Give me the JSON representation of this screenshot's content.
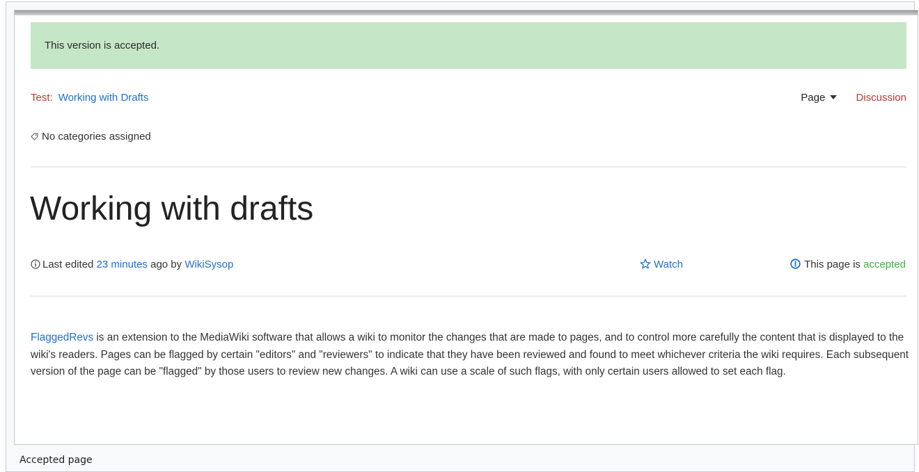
{
  "banner": {
    "text": "This version is accepted."
  },
  "breadcrumb": {
    "namespace": "Test:",
    "page_link": "Working with Drafts"
  },
  "nav": {
    "page_label": "Page",
    "discussion_label": "Discussion"
  },
  "categories": {
    "text": "No categories assigned"
  },
  "page": {
    "title": "Working with drafts"
  },
  "meta": {
    "prefix": "Last edited",
    "time_link": "23 minutes",
    "middle": "ago by",
    "user_link": "WikiSysop",
    "watch_label": "Watch",
    "status_prefix": "This page is",
    "status_word": "accepted"
  },
  "content": {
    "link": "FlaggedRevs",
    "paragraph": "is an extension to the MediaWiki software that allows a wiki to monitor the changes that are made to pages, and to control more carefully the content that is displayed to the wiki's readers. Pages can be flagged by certain \"editors\" and \"reviewers\" to indicate that they have been reviewed and found to meet whichever criteria the wiki requires. Each subsequent version of the page can be \"flagged\" by those users to review new changes. A wiki can use a scale of such flags, with only certain users allowed to set each flag."
  },
  "caption": {
    "text": "Accepted page"
  },
  "colors": {
    "banner_bg": "#c5e6c7",
    "link": "#1f6fd0",
    "namespace": "#c0392b",
    "accepted": "#3cb043"
  }
}
